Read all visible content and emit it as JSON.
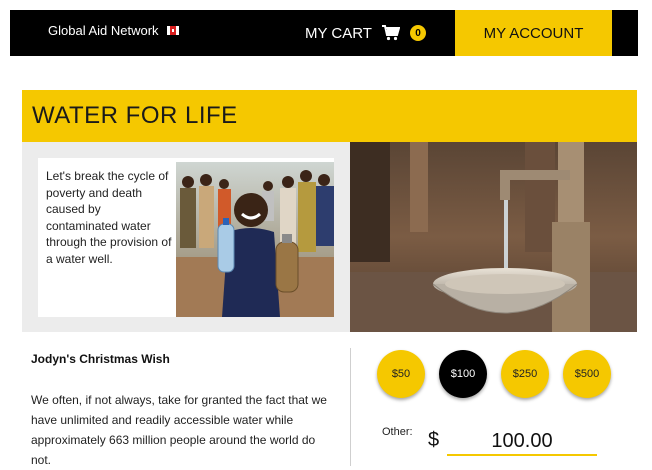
{
  "header": {
    "brand": "Global Aid Network",
    "flag_icon": "canada-flag-icon",
    "cart_label": "MY CART",
    "cart_icon": "shopping-cart-icon",
    "cart_count": "0",
    "account_label": "MY ACCOUNT"
  },
  "banner": {
    "title": "WATER FOR LIFE"
  },
  "intro": {
    "text": "Let's break the cycle of poverty and death caused by contaminated water through the provision of a water well."
  },
  "story": {
    "title": "Jodyn's Christmas Wish",
    "text": "We often, if not always, take for granted the fact that we have unlimited and readily accessible water while approximately 663 million people around the world do not."
  },
  "donation": {
    "amounts": [
      "$50",
      "$100",
      "$250",
      "$500"
    ],
    "selected": "$100",
    "other_label": "Other:",
    "currency_symbol": "$",
    "other_value": "100.00"
  },
  "colors": {
    "accent": "#f5c800",
    "header_bg": "#000000",
    "panel_bg": "#ececec"
  }
}
